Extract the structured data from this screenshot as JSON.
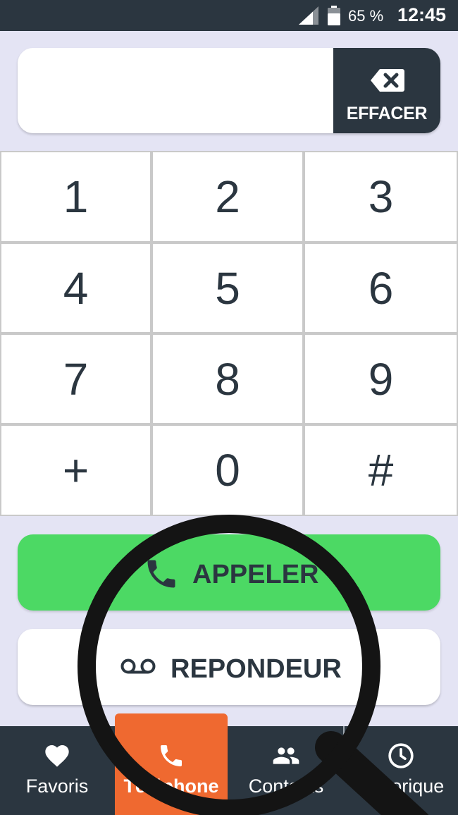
{
  "status_bar": {
    "battery_percent": "65 %",
    "time": "12:45",
    "icons": [
      "signal-icon",
      "battery-icon"
    ]
  },
  "number_display": {
    "value": "",
    "clear_label": "EFFACER",
    "clear_icon": "backspace-icon"
  },
  "keypad": {
    "keys": [
      "1",
      "2",
      "3",
      "4",
      "5",
      "6",
      "7",
      "8",
      "9",
      "+",
      "0",
      "#"
    ]
  },
  "actions": {
    "call_label": "APPELER",
    "call_icon": "phone-icon",
    "voicemail_label": "REPONDEUR",
    "voicemail_icon": "voicemail-icon"
  },
  "bottom_nav": {
    "items": [
      {
        "label": "Favoris",
        "icon": "heart-icon"
      },
      {
        "label": "Téléphone",
        "icon": "phone-icon"
      },
      {
        "label": "Contacts",
        "icon": "people-icon"
      },
      {
        "label": "Historique",
        "icon": "clock-icon"
      }
    ],
    "active": "Téléphone"
  },
  "colors": {
    "background": "#e4e4f4",
    "dark": "#2b3640",
    "call_green": "#4cd964",
    "active_orange": "#ef6930",
    "white": "#ffffff"
  }
}
